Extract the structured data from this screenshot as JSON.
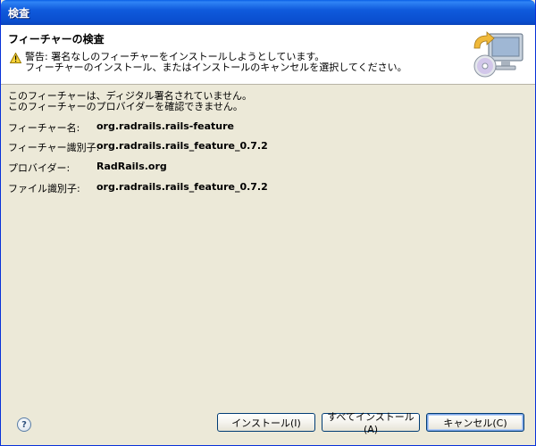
{
  "window": {
    "title": "検査"
  },
  "banner": {
    "title": "フィーチャーの検査",
    "warning_line1": "警告: 署名なしのフィーチャーをインストールしようとしています。",
    "warning_line2": "フィーチャーのインストール、またはインストールのキャンセルを選択してください。",
    "warning_icon": "warning-triangle-icon",
    "image_icon": "install-cd-computer-icon"
  },
  "content": {
    "signature_line1": "このフィーチャーは、ディジタル署名されていません。",
    "signature_line2": "このフィーチャーのプロバイダーを確認できません。",
    "fields": [
      {
        "label": "フィーチャー名:",
        "value": "org.radrails.rails-feature"
      },
      {
        "label": "フィーチャー識別子:",
        "value": "org.radrails.rails_feature_0.7.2"
      },
      {
        "label": "プロバイダー:",
        "value": "RadRails.org"
      },
      {
        "label": "ファイル識別子:",
        "value": "org.radrails.rails_feature_0.7.2"
      }
    ]
  },
  "buttons": {
    "help": "?",
    "install": "インストール(I)",
    "install_all": "すべてインストール(A)",
    "cancel": "キャンセル(C)"
  },
  "colors": {
    "titlebar": "#0a5fe6",
    "dialog_bg": "#ece9d8",
    "button_border": "#003c74"
  }
}
